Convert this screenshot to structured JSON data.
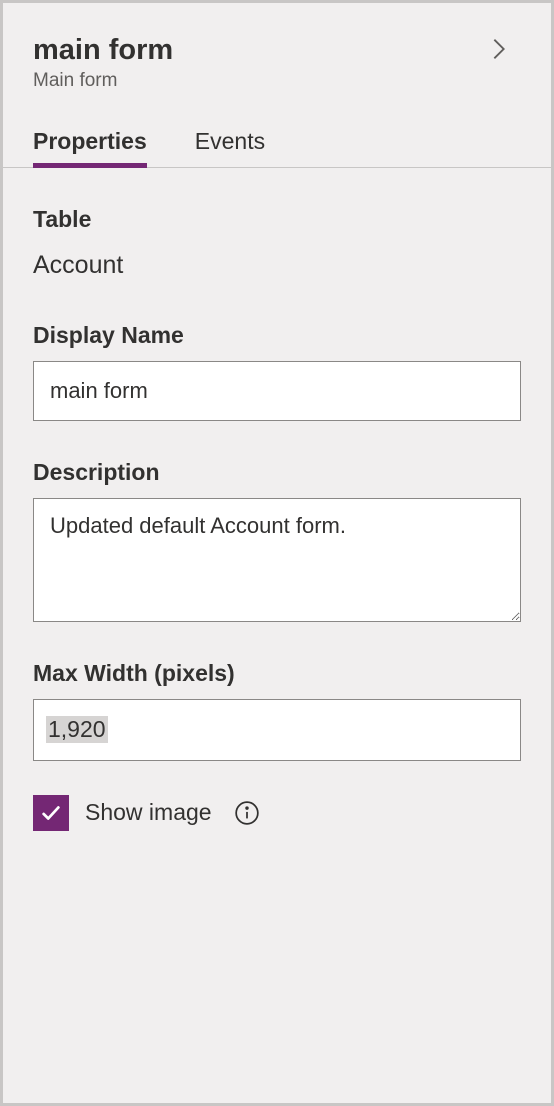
{
  "header": {
    "title": "main form",
    "subtitle": "Main form"
  },
  "tabs": {
    "properties": "Properties",
    "events": "Events"
  },
  "colors": {
    "accent": "#742774"
  },
  "form": {
    "table_label": "Table",
    "table_value": "Account",
    "display_name_label": "Display Name",
    "display_name_value": "main form",
    "description_label": "Description",
    "description_value": "Updated default Account form.",
    "max_width_label": "Max Width (pixels)",
    "max_width_value": "1,920",
    "show_image_label": "Show image",
    "show_image_checked": true
  }
}
